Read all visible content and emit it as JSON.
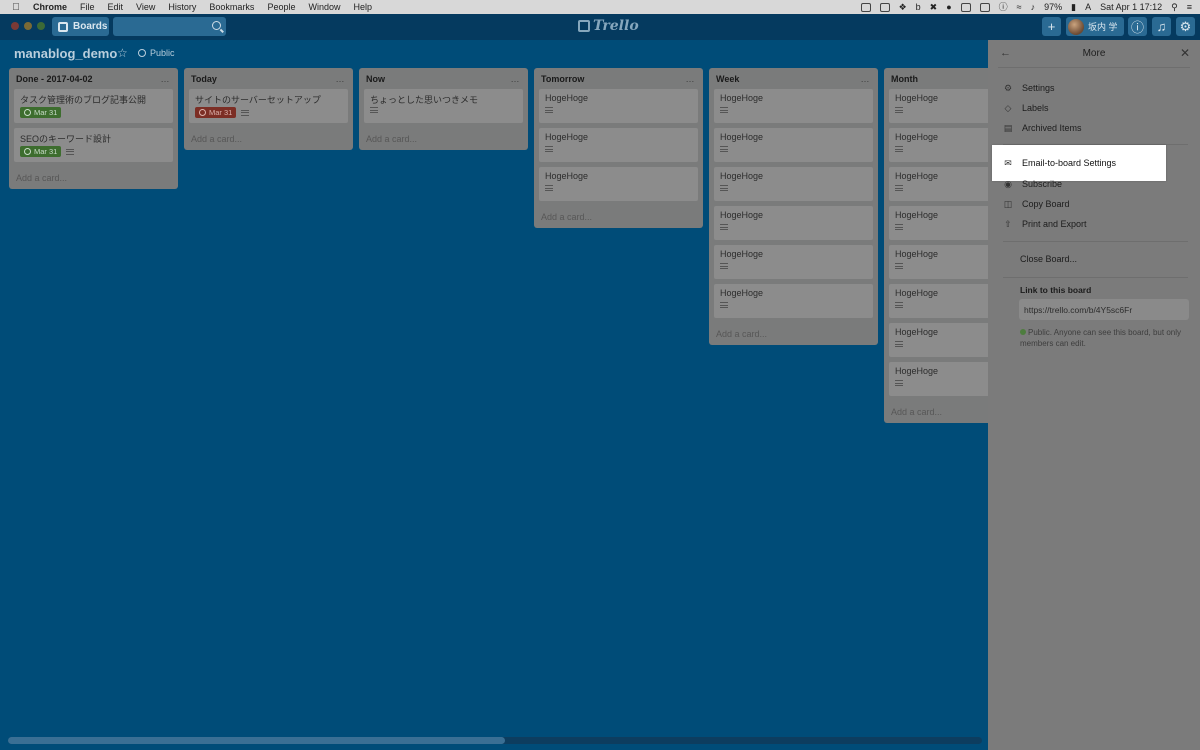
{
  "menubar": {
    "app": "Chrome",
    "items": [
      "File",
      "Edit",
      "View",
      "History",
      "Bookmarks",
      "People",
      "Window",
      "Help"
    ],
    "battery": "97%",
    "datetime": "Sat Apr 1  17:12"
  },
  "header": {
    "boards_label": "Boards",
    "search_value": "",
    "logo": "Trello",
    "username": "坂内 学"
  },
  "board": {
    "title": "manablog_demo",
    "visibility": "Public"
  },
  "lists": [
    {
      "title": "Done - 2017-04-02",
      "cards": [
        {
          "title": "タスク管理術のブログ記事公開",
          "due": "Mar 31",
          "due_color": "green",
          "desc": false
        },
        {
          "title": "SEOのキーワード設計",
          "due": "Mar 31",
          "due_color": "green",
          "desc": true
        }
      ],
      "add": "Add a card..."
    },
    {
      "title": "Today",
      "cards": [
        {
          "title": "サイトのサーバーセットアップ",
          "due": "Mar 31",
          "due_color": "red",
          "desc": true
        }
      ],
      "add": "Add a card..."
    },
    {
      "title": "Now",
      "cards": [
        {
          "title": "ちょっとした思いつきメモ",
          "due": "",
          "due_color": "",
          "desc": true
        }
      ],
      "add": "Add a card..."
    },
    {
      "title": "Tomorrow",
      "cards": [
        {
          "title": "HogeHoge",
          "due": "",
          "due_color": "",
          "desc": true
        },
        {
          "title": "HogeHoge",
          "due": "",
          "due_color": "",
          "desc": true
        },
        {
          "title": "HogeHoge",
          "due": "",
          "due_color": "",
          "desc": true
        }
      ],
      "add": "Add a card..."
    },
    {
      "title": "Week",
      "cards": [
        {
          "title": "HogeHoge",
          "due": "",
          "due_color": "",
          "desc": true
        },
        {
          "title": "HogeHoge",
          "due": "",
          "due_color": "",
          "desc": true
        },
        {
          "title": "HogeHoge",
          "due": "",
          "due_color": "",
          "desc": true
        },
        {
          "title": "HogeHoge",
          "due": "",
          "due_color": "",
          "desc": true
        },
        {
          "title": "HogeHoge",
          "due": "",
          "due_color": "",
          "desc": true
        },
        {
          "title": "HogeHoge",
          "due": "",
          "due_color": "",
          "desc": true
        }
      ],
      "add": "Add a card..."
    },
    {
      "title": "Month",
      "cards": [
        {
          "title": "HogeHoge",
          "due": "",
          "due_color": "",
          "desc": true
        },
        {
          "title": "HogeHoge",
          "due": "",
          "due_color": "",
          "desc": true
        },
        {
          "title": "HogeHoge",
          "due": "",
          "due_color": "",
          "desc": true
        },
        {
          "title": "HogeHoge",
          "due": "",
          "due_color": "",
          "desc": true
        },
        {
          "title": "HogeHoge",
          "due": "",
          "due_color": "",
          "desc": true
        },
        {
          "title": "HogeHoge",
          "due": "",
          "due_color": "",
          "desc": true
        },
        {
          "title": "HogeHoge",
          "due": "",
          "due_color": "",
          "desc": true
        },
        {
          "title": "HogeHoge",
          "due": "",
          "due_color": "",
          "desc": true
        }
      ],
      "add": "Add a card..."
    }
  ],
  "sidemenu": {
    "title": "More",
    "items": [
      {
        "label": "Settings",
        "icon": "gear-icon"
      },
      {
        "label": "Labels",
        "icon": "tag-icon"
      },
      {
        "label": "Archived Items",
        "icon": "archive-icon"
      },
      {
        "label": "Email-to-board Settings",
        "icon": "mail-icon"
      },
      {
        "label": "Subscribe",
        "icon": "eye-icon"
      },
      {
        "label": "Copy Board",
        "icon": "copy-icon"
      },
      {
        "label": "Print and Export",
        "icon": "share-icon"
      }
    ],
    "close_board": "Close Board...",
    "link_label": "Link to this board",
    "link_value": "https://trello.com/b/4Y5sc6Fr",
    "link_note": "Public. Anyone can see this board, but only members can edit."
  },
  "colors": {
    "board_bg": "#004c78",
    "due_green": "#3d6d2e",
    "due_red": "#7c2e25",
    "highlight": "#ffffff"
  }
}
